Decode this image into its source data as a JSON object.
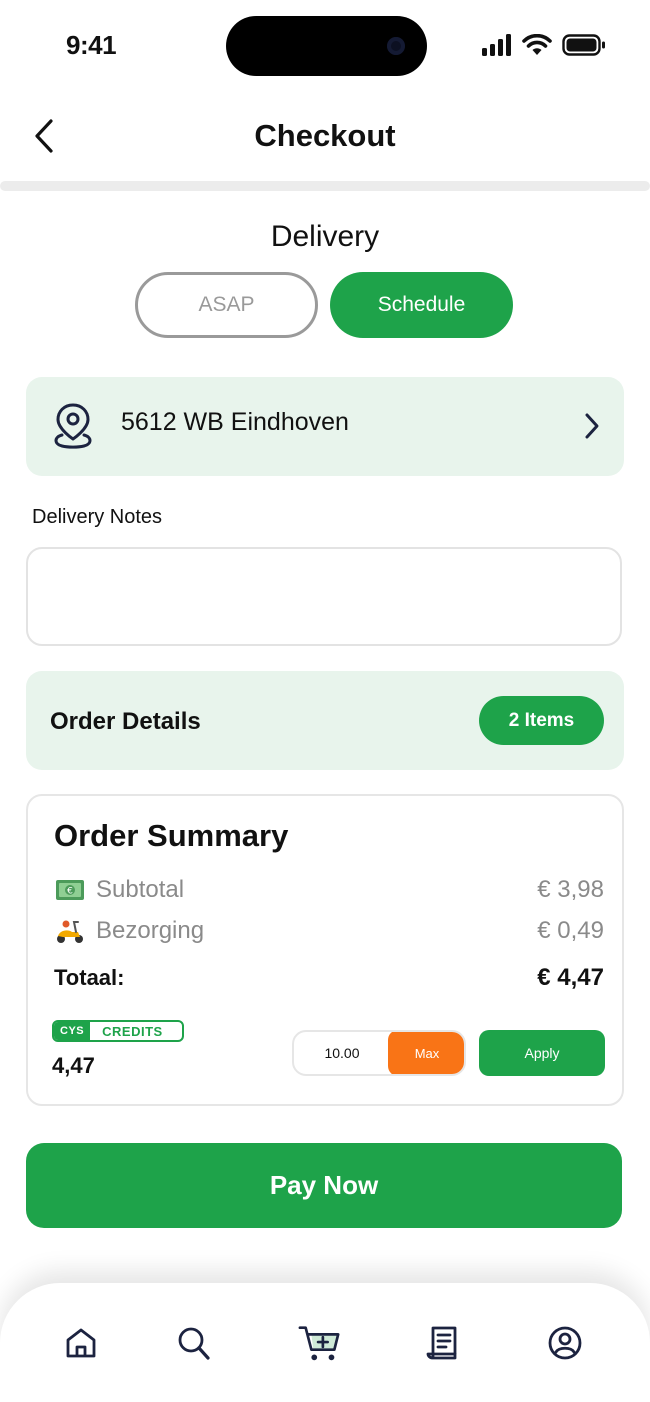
{
  "status_bar": {
    "time": "9:41"
  },
  "header": {
    "title": "Checkout"
  },
  "delivery": {
    "title": "Delivery",
    "options": [
      {
        "label": "ASAP",
        "selected": false
      },
      {
        "label": "Schedule",
        "selected": true
      }
    ]
  },
  "address": {
    "text": "5612 WB Eindhoven"
  },
  "notes": {
    "label": "Delivery Notes",
    "value": "",
    "placeholder": ""
  },
  "order_details": {
    "title": "Order Details",
    "items_badge": "2 Items"
  },
  "summary": {
    "title": "Order Summary",
    "subtotal_label": "Subtotal",
    "subtotal_value": "€ 3,98",
    "delivery_label": "Bezorging",
    "delivery_value": "€ 0,49",
    "total_label": "Totaal:",
    "total_value": "€ 4,47"
  },
  "credits": {
    "logo": "CYS",
    "label": "CREDITS",
    "balance": "4,47",
    "input_value": "10.00",
    "max_label": "Max",
    "apply_label": "Apply"
  },
  "pay": {
    "label": "Pay Now"
  },
  "colors": {
    "accent": "#1ea34a",
    "max": "#f97416",
    "tint": "#e8f4ec"
  },
  "bottom_nav": {
    "items": [
      {
        "icon": "home-icon"
      },
      {
        "icon": "search-icon"
      },
      {
        "icon": "cart-icon",
        "active": true
      },
      {
        "icon": "receipt-icon"
      },
      {
        "icon": "profile-icon"
      }
    ]
  }
}
